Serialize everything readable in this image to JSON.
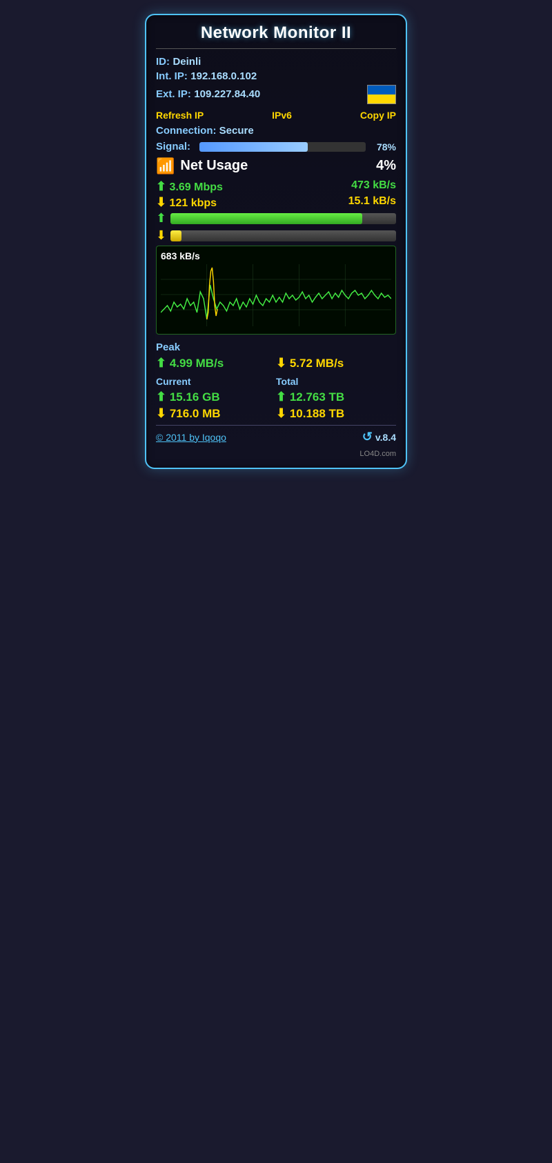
{
  "title": "Network Monitor II",
  "info": {
    "id_label": "ID:",
    "id_value": "Deinli",
    "int_ip_label": "Int. IP:",
    "int_ip_value": "192.168.0.102",
    "ext_ip_label": "Ext. IP:",
    "ext_ip_value": "109.227.84.40",
    "flag_country": "Ukraine"
  },
  "actions": {
    "refresh_ip": "Refresh IP",
    "ipv6": "IPv6",
    "copy_ip": "Copy IP"
  },
  "connection": {
    "label": "Connection:",
    "value": "Secure"
  },
  "signal": {
    "label": "Signal:",
    "percent": "78%",
    "fill_width": "65"
  },
  "net_usage": {
    "label": "Net Usage",
    "percent": "4%"
  },
  "speeds": {
    "upload_mbps": "3.69 Mbps",
    "upload_kbs": "473 kB/s",
    "download_kbps": "121 kbps",
    "download_kbs": "15.1 kB/s",
    "upload_bar_pct": "85",
    "download_bar_pct": "5"
  },
  "graph": {
    "label": "683 kB/s"
  },
  "peak": {
    "title": "Peak",
    "upload": "4.99 MB/s",
    "download": "5.72 MB/s"
  },
  "current": {
    "label": "Current",
    "upload": "15.16 GB",
    "download": "716.0 MB"
  },
  "total": {
    "label": "Total",
    "upload": "12.763 TB",
    "download": "10.188 TB"
  },
  "footer": {
    "link_text": "© 2011 by Iqoqo",
    "version": "v.8.4"
  },
  "watermark": "LO4D.com"
}
